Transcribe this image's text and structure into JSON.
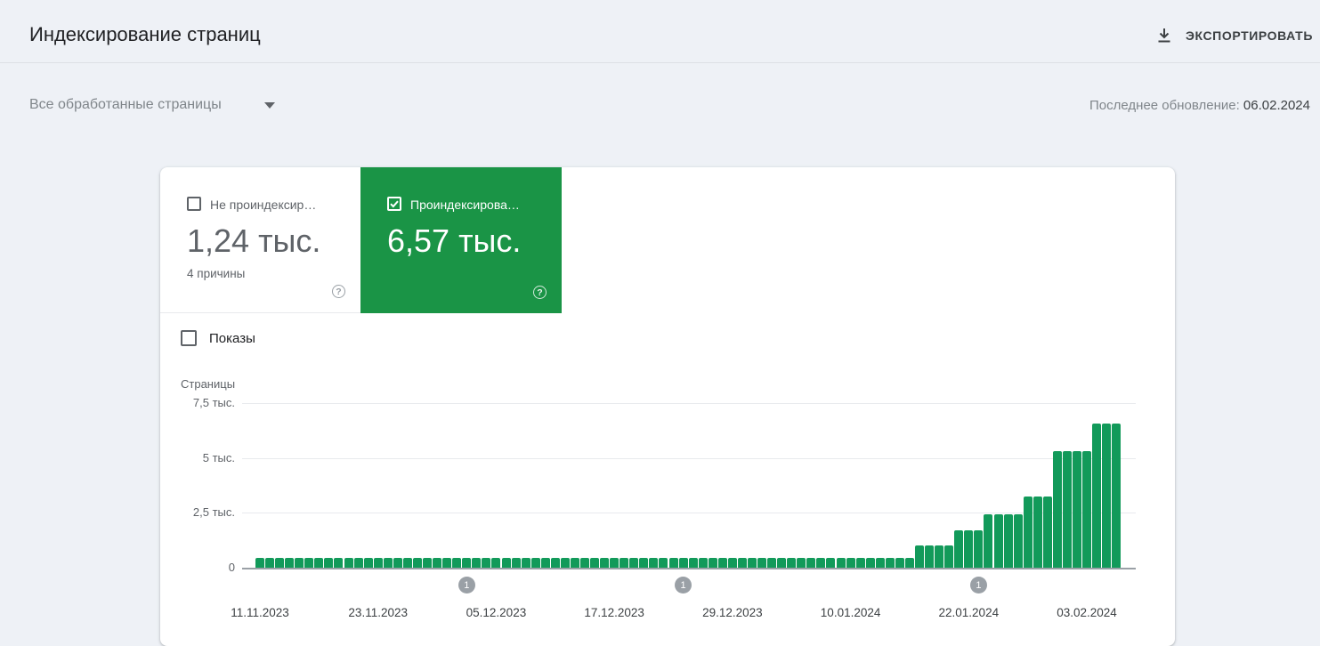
{
  "theme": {
    "page_bg": "#eef1f6",
    "indexed_green": "#1a9446",
    "bar_green": "#129a5a",
    "marker_gray": "#9aa0a6"
  },
  "header": {
    "title": "Индексирование страниц",
    "export_label": "ЭКСПОРТИРОВАТЬ"
  },
  "filter_bar": {
    "filter_label": "Все обработанные страницы",
    "last_update_label": "Последнее обновление:",
    "last_update_date": "06.02.2024"
  },
  "tiles": {
    "not_indexed": {
      "label": "Не проиндексир…",
      "value": "1,24 тыс.",
      "sub": "4 причины",
      "checked": false,
      "help_glyph": "?"
    },
    "indexed": {
      "label": "Проиндексирова…",
      "value": "6,57 тыс.",
      "checked": true,
      "help_glyph": "?"
    }
  },
  "impressions_toggle": {
    "label": "Показы",
    "checked": false
  },
  "chart_data": {
    "type": "bar",
    "ylabel": "Страницы",
    "date_start": "11.11.2023",
    "date_end": "06.02.2024",
    "grid": true,
    "ylim": [
      0,
      7500
    ],
    "yticks": [
      {
        "value": 0,
        "label": "0"
      },
      {
        "value": 2500,
        "label": "2,5 тыс."
      },
      {
        "value": 5000,
        "label": "5 тыс."
      },
      {
        "value": 7500,
        "label": "7,5 тыс."
      }
    ],
    "x_ticks": [
      {
        "label": "11.11.2023",
        "bar_index": 0
      },
      {
        "label": "23.11.2023",
        "bar_index": 12
      },
      {
        "label": "05.12.2023",
        "bar_index": 24
      },
      {
        "label": "17.12.2023",
        "bar_index": 36
      },
      {
        "label": "29.12.2023",
        "bar_index": 48
      },
      {
        "label": "10.01.2024",
        "bar_index": 60
      },
      {
        "label": "22.01.2024",
        "bar_index": 72
      },
      {
        "label": "03.02.2024",
        "bar_index": 84
      }
    ],
    "markers": [
      {
        "label": "1",
        "bar_index": 21
      },
      {
        "label": "1",
        "bar_index": 43
      },
      {
        "label": "1",
        "bar_index": 73
      }
    ],
    "values": [
      450,
      450,
      450,
      450,
      450,
      450,
      450,
      450,
      450,
      450,
      450,
      450,
      450,
      450,
      450,
      450,
      450,
      450,
      450,
      450,
      450,
      450,
      450,
      450,
      450,
      450,
      450,
      450,
      450,
      450,
      450,
      450,
      450,
      450,
      450,
      450,
      450,
      450,
      450,
      450,
      450,
      450,
      450,
      450,
      450,
      450,
      450,
      450,
      450,
      450,
      450,
      450,
      450,
      450,
      450,
      450,
      450,
      450,
      450,
      450,
      450,
      450,
      450,
      450,
      450,
      450,
      450,
      1000,
      1000,
      1000,
      1000,
      1700,
      1700,
      1700,
      2450,
      2450,
      2450,
      2450,
      3250,
      3250,
      3250,
      5300,
      5300,
      5300,
      5300,
      6570,
      6570,
      6570
    ]
  }
}
